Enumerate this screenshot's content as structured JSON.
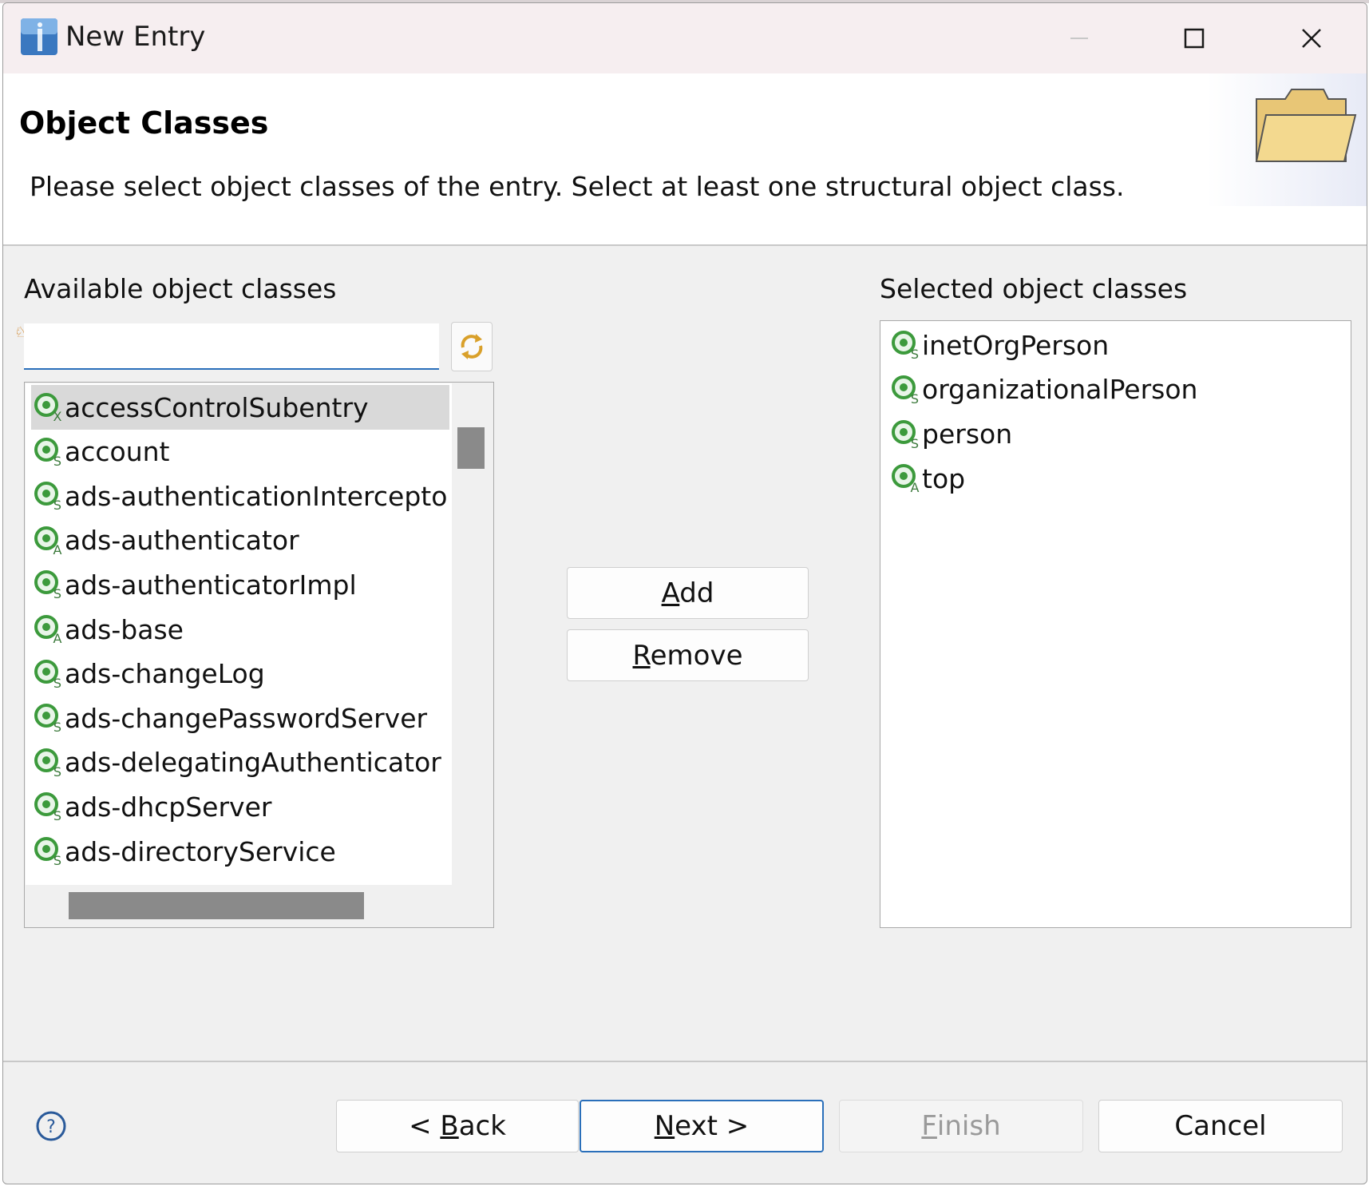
{
  "window": {
    "title": "New Entry",
    "controls": {
      "minimize": "minimize-icon",
      "maximize": "maximize-icon",
      "close": "close-icon"
    }
  },
  "header": {
    "title": "Object Classes",
    "description": "Please select object classes of the entry. Select at least one structural object class."
  },
  "available": {
    "label": "Available object classes",
    "filter_value": "",
    "items": [
      {
        "name": "accessControlSubentry",
        "kind": "X",
        "selected": true
      },
      {
        "name": "account",
        "kind": "S"
      },
      {
        "name": "ads-authenticationIntercepto",
        "kind": "S"
      },
      {
        "name": "ads-authenticator",
        "kind": "A"
      },
      {
        "name": "ads-authenticatorImpl",
        "kind": "S"
      },
      {
        "name": "ads-base",
        "kind": "A"
      },
      {
        "name": "ads-changeLog",
        "kind": "S"
      },
      {
        "name": "ads-changePasswordServer",
        "kind": "S"
      },
      {
        "name": "ads-delegatingAuthenticator",
        "kind": "S"
      },
      {
        "name": "ads-dhcpServer",
        "kind": "S"
      },
      {
        "name": "ads-directoryService",
        "kind": "S"
      }
    ]
  },
  "actions": {
    "add_label": "Add",
    "remove_label": "Remove"
  },
  "selected": {
    "label": "Selected object classes",
    "items": [
      {
        "name": "inetOrgPerson",
        "kind": "S"
      },
      {
        "name": "organizationalPerson",
        "kind": "S"
      },
      {
        "name": "person",
        "kind": "S"
      },
      {
        "name": "top",
        "kind": "A"
      }
    ]
  },
  "footer": {
    "back_prefix": "< ",
    "back_mnemonic": "B",
    "back_rest": "ack",
    "next_mnemonic": "N",
    "next_rest": "ext >",
    "finish_mnemonic": "F",
    "finish_rest": "inish",
    "cancel_label": "Cancel"
  },
  "colors": {
    "accent": "#2a6fba",
    "icon_green": "#3c9a3c",
    "selection": "#d9d9d9",
    "title_bar": "#f6eef0"
  }
}
